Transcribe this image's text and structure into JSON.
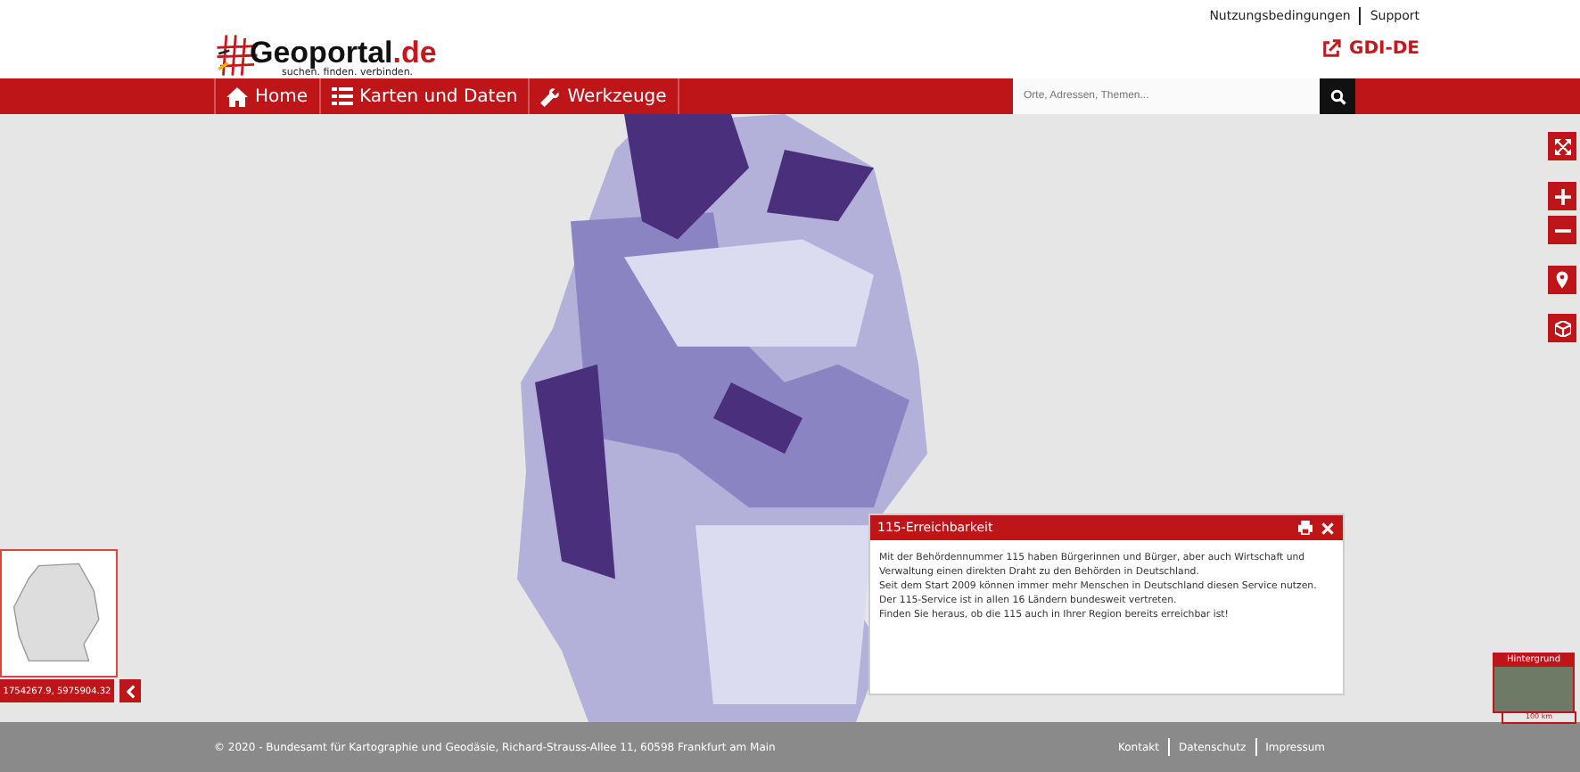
{
  "header": {
    "logo_name": "Geoportal",
    "logo_tld": ".de",
    "logo_tagline": "suchen. finden. verbinden.",
    "top_links": [
      "Nutzungsbedingungen",
      "Support"
    ],
    "partner_link": "GDI-DE"
  },
  "nav": {
    "items": [
      "Home",
      "Karten und Daten",
      "Werkzeuge"
    ],
    "search": {
      "placeholder": "Orte, Adressen, Themen..."
    }
  },
  "map": {
    "popup": {
      "title": "115-Erreichbarkeit",
      "paragraphs": [
        "Mit der Behördennummer 115 haben Bürgerinnen und Bürger, aber auch Wirtschaft und Verwaltung einen direkten Draht zu den Behörden in Deutschland.",
        "Seit dem Start 2009 können immer mehr Menschen in Deutschland diesen Service nutzen. Der 115-Service ist in allen 16 Ländern bundesweit vertreten.",
        "Finden Sie heraus, ob die 115 auch in Ihrer Region bereits erreichbar ist!"
      ]
    },
    "coordinates": "1754267.9, 5975904.32",
    "background_label": "Hintergrund",
    "scale": "100 km"
  },
  "footer": {
    "copyright": "© 2020 - Bundesamt für Kartographie und Geodäsie, Richard-Strauss-Allee 11, 60598 Frankfurt am Main",
    "links": [
      "Kontakt",
      "Datenschutz",
      "Impressum"
    ]
  }
}
